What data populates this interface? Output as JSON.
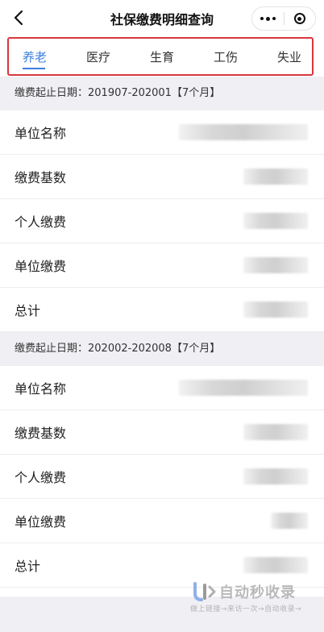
{
  "header": {
    "title": "社保缴费明细查询",
    "back_icon": "back-chevron-icon",
    "more_icon": "more-dots-icon",
    "close_icon": "target-circle-icon"
  },
  "tabs": [
    {
      "label": "养老",
      "active": true
    },
    {
      "label": "医疗",
      "active": false
    },
    {
      "label": "生育",
      "active": false
    },
    {
      "label": "工伤",
      "active": false
    },
    {
      "label": "失业",
      "active": false
    }
  ],
  "accent_color": "#3b7fe0",
  "highlight_border_color": "#d9363e",
  "sections": [
    {
      "period": "缴费起止日期：201907-202001【7个月】",
      "rows": [
        {
          "label": "单位名称",
          "value": "(blurred)"
        },
        {
          "label": "缴费基数",
          "value": "(blurred)"
        },
        {
          "label": "个人缴费",
          "value": "(blurred)"
        },
        {
          "label": "单位缴费",
          "value": "(blurred)"
        },
        {
          "label": "总计",
          "value": "(blurred)"
        }
      ]
    },
    {
      "period": "缴费起止日期：202002-202008【7个月】",
      "rows": [
        {
          "label": "单位名称",
          "value": "(blurred)"
        },
        {
          "label": "缴费基数",
          "value": "(blurred)"
        },
        {
          "label": "个人缴费",
          "value": "(blurred)"
        },
        {
          "label": "单位缴费",
          "value": "(blurred)"
        },
        {
          "label": "总计",
          "value": "(blurred)"
        }
      ]
    }
  ],
  "watermark": {
    "title": "自动秒收录",
    "subtitle": "做上链接→来访一次→自动收录→"
  }
}
